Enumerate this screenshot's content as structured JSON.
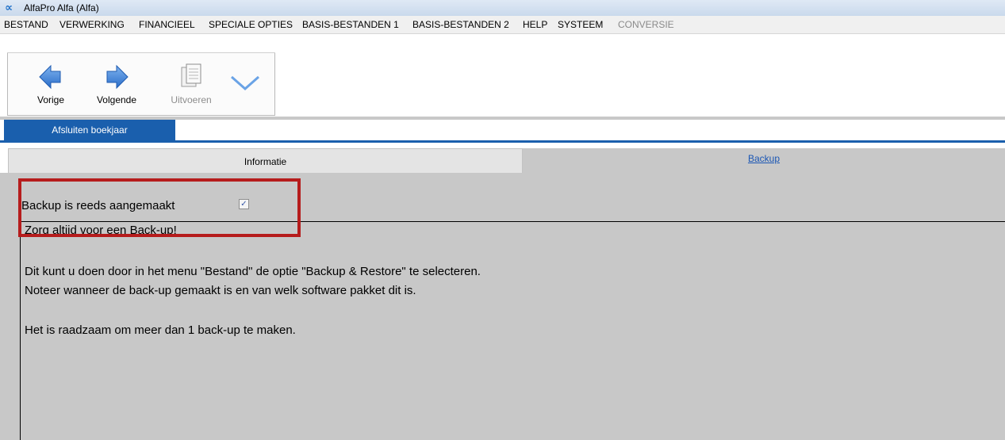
{
  "window": {
    "title": "AlfaPro Alfa (Alfa)",
    "logo_glyph": "∝"
  },
  "menu": {
    "items": [
      {
        "label": "BESTAND",
        "enabled": true
      },
      {
        "label": "VERWERKING",
        "enabled": true
      },
      {
        "label": "FINANCIEEL",
        "enabled": true
      },
      {
        "label": "SPECIALE OPTIES",
        "enabled": true
      },
      {
        "label": "BASIS-BESTANDEN 1",
        "enabled": true
      },
      {
        "label": "BASIS-BESTANDEN 2",
        "enabled": true
      },
      {
        "label": "HELP",
        "enabled": true
      },
      {
        "label": "SYSTEEM",
        "enabled": true
      },
      {
        "label": "CONVERSIE",
        "enabled": false
      }
    ]
  },
  "toolbar": {
    "prev_label": "Vorige",
    "next_label": "Volgende",
    "run_label": "Uitvoeren",
    "prev_icon": "arrow-left-icon",
    "next_icon": "arrow-right-icon",
    "run_icon": "document-icon",
    "more_icon": "chevron-down-icon",
    "accent_color": "#3a7fd6"
  },
  "document_tab": {
    "label": "Afsluiten boekjaar"
  },
  "sub_tabs": {
    "info_label": "Informatie",
    "backup_label": "Backup"
  },
  "backup_panel": {
    "checkbox_label": "Backup is reeds aangemaakt",
    "checkbox_checked": true,
    "checkbox_mark": "✓",
    "lines": [
      "Zorg altijd voor een Back-up!",
      "",
      "Dit kunt u doen door in het menu \"Bestand\" de optie \"Backup & Restore\" te selecteren.",
      "Noteer wanneer de back-up gemaakt is en van welk software pakket dit is.",
      "",
      "Het is raadzaam om meer dan 1 back-up te maken."
    ]
  },
  "colors": {
    "highlight": "#b61c1c",
    "tab_blue": "#1a5fad",
    "link_blue": "#1a56b4"
  }
}
